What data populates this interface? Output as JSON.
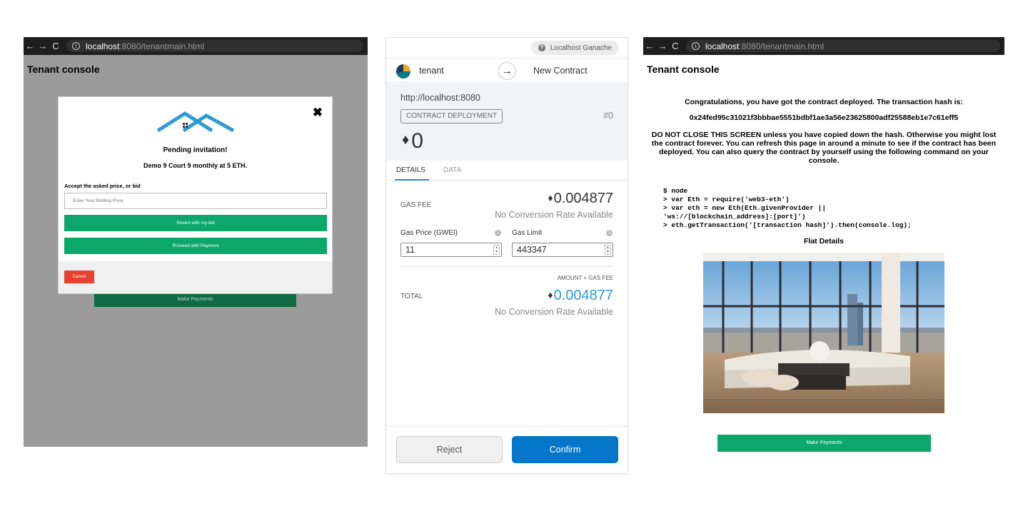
{
  "left_panel": {
    "browser": {
      "url_host": "localhost",
      "url_path": ":8080/tenantmain.html",
      "back_icon": "←",
      "forward_icon": "→",
      "reload_icon": "C",
      "info_icon": "i"
    },
    "page_title": "Tenant console",
    "background_button": "Make Payments",
    "modal": {
      "close_label": "✖",
      "title": "Pending invitation!",
      "subtitle": "Demo 9 Court 9 monthly at 5 ETH.",
      "bid_label": "Accept the asked price, or bid",
      "bid_placeholder": "Enter Your Bidding Price",
      "revert_button": "Revert with my bid",
      "proceed_button": "Proceed with Payment",
      "cancel_button": "Cancel"
    }
  },
  "metamask": {
    "network": "Localhost Ganache",
    "network_icon": "?",
    "account_name": "tenant",
    "arrow_icon": "→",
    "target": "New Contract",
    "origin": "http://localhost:8080",
    "action_badge": "CONTRACT DEPLOYMENT",
    "nonce": "#0",
    "eth_symbol": "♦",
    "amount": "0",
    "tabs": [
      "DETAILS",
      "DATA"
    ],
    "gas_fee_label": "GAS FEE",
    "gas_fee_value": "0.004877",
    "gas_fee_rate": "No Conversion Rate Available",
    "gas_price_label": "Gas Price (GWEI)",
    "gas_price_value": "11",
    "gas_limit_label": "Gas Limit",
    "gas_limit_value": "443347",
    "info_icon": "i",
    "spinner_up": "▲",
    "spinner_down": "▼",
    "amount_plus_gas_label": "AMOUNT + GAS FEE",
    "total_label": "TOTAL",
    "total_value": "0.004877",
    "total_rate": "No Conversion Rate Available",
    "reject_button": "Reject",
    "confirm_button": "Confirm"
  },
  "right_panel": {
    "browser": {
      "url_host": "localhost",
      "url_path": ":8080/tenantmain.html",
      "back_icon": "←",
      "forward_icon": "→",
      "reload_icon": "C",
      "info_icon": "i"
    },
    "page_title": "Tenant console",
    "congrats": "Congratulations, you have got the contract deployed. The transaction hash is:",
    "tx_hash": "0x24fed95c31021f3bbbae5551bdbf1ae3a56e23625800adf25588eb1e7c61eff5",
    "warning": "DO NOT CLOSE THIS SCREEN unless you have copied down the hash. Otherwise you might lost the contract forever. You can refresh this page in around a minute to see if the contract has been deployed. You can also query the contract by yourself using the following command on your console.",
    "console_lines": [
      "$ node",
      "> var Eth = require('web3-eth')",
      "> var eth = new Eth(Eth.givenProvider ||",
      "'ws://[blockchain_address]:[port]')",
      "> eth.getTransaction('[transaction hash]').then(console.log);"
    ],
    "flat_title": "Flat Details",
    "make_payments_button": "Make Payments"
  },
  "colors": {
    "green_button": "#0ca86b",
    "cancel_red": "#e8402f",
    "confirm_blue": "#0376c9",
    "overlay_gray": "#9b9b9b",
    "total_blue": "#2f9ae0"
  }
}
